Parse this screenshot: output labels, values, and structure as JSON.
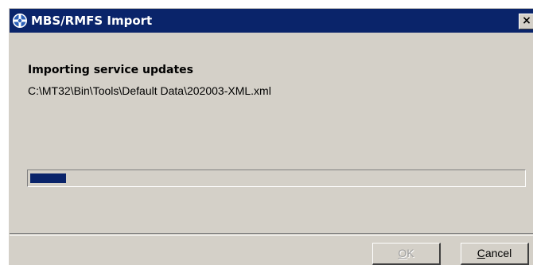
{
  "window": {
    "title": "MBS/RMFS Import",
    "close_glyph": "×",
    "icon": "app-help-icon"
  },
  "content": {
    "heading": "Importing service updates",
    "filepath": "C:\\MT32\\Bin\\Tools\\Default Data\\202003-XML.xml"
  },
  "progress": {
    "fraction": 0.072
  },
  "buttons": {
    "ok": {
      "mnemonic": "O",
      "rest": "K",
      "enabled": false
    },
    "cancel": {
      "mnemonic": "C",
      "rest": "ancel",
      "enabled": true
    }
  },
  "colors": {
    "titlebar": "#0a246a",
    "face": "#d4d0c8",
    "progress": "#0a246a"
  }
}
